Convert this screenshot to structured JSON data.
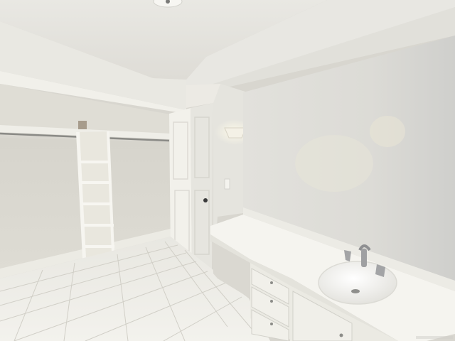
{
  "scene": {
    "subject": "empty-room-with-closet-and-vanity",
    "colors": {
      "ceiling": "#ecebe6",
      "wall_left": "#e6e4dc",
      "wall_right": "#dcdbd6",
      "closet_interior": "#d9d7cf",
      "floor_tile": "#eeede7",
      "grout": "#cfcdc6",
      "countertop": "#f4f3ee",
      "cabinet": "#ecebe4",
      "door": "#f0efe9",
      "sink": "#f7f6f2",
      "fixture_light": "#fffbe9",
      "metal": "#9a9b9d"
    }
  }
}
